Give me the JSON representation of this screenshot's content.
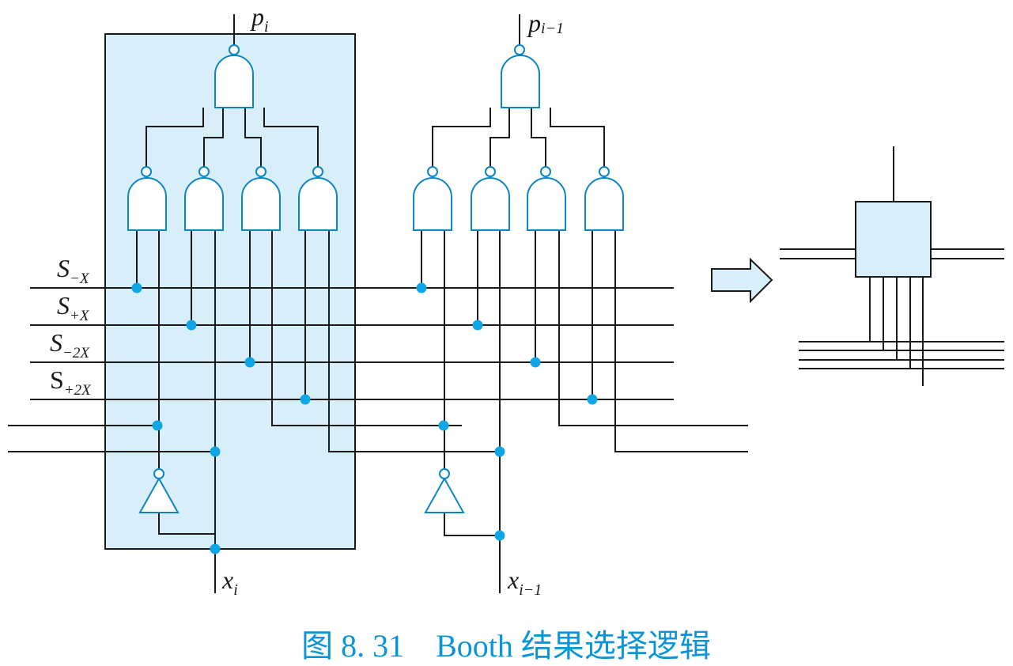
{
  "labels": {
    "p_i_main": "p",
    "p_i_sub": "i",
    "p_im1_main": "p",
    "p_im1_sub": "i−1",
    "x_i_main": "x",
    "x_i_sub": "i",
    "x_im1_main": "x",
    "x_im1_sub": "i−1",
    "s_neg_x_main": "S",
    "s_neg_x_sub": "−X",
    "s_pos_x_main": "S",
    "s_pos_x_sub": "+X",
    "s_neg_2x_main": "S",
    "s_neg_2x_sub": "−2X",
    "s_pos_2x_main": "S",
    "s_pos_2x_sub": "+2X"
  },
  "caption": "图 8. 31　Booth 结果选择逻辑",
  "colors": {
    "cell_fill": "#d8eef8",
    "gate_stroke": "#0a86c4",
    "junction_dot": "#0fa6e6",
    "wire": "#1a1a1a",
    "caption_text": "#0a95d8"
  }
}
